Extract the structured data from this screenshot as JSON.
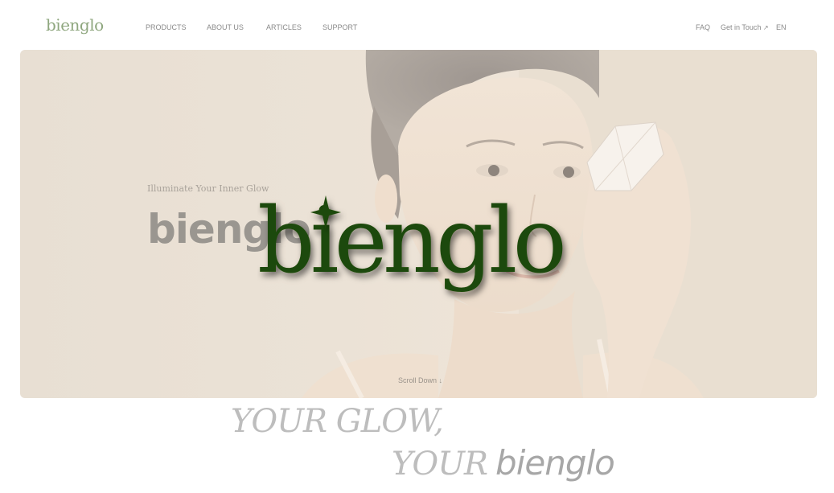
{
  "header": {
    "logo": "bienglo",
    "nav": [
      {
        "label": "PRODUCTS"
      },
      {
        "label": "ABOUT US"
      },
      {
        "label": "ARTICLES"
      },
      {
        "label": "SUPPORT"
      }
    ],
    "utility": {
      "faq": "FAQ",
      "contact": "Get in Touch",
      "contact_icon": "arrow-up-right-icon",
      "language": "EN"
    }
  },
  "hero": {
    "tagline": "Illuminate Your Inner Glow",
    "brand": "bienglo",
    "scroll_label": "Scroll Down",
    "scroll_icon": "arrow-down-icon"
  },
  "overlay": {
    "logo_text": "bienglo",
    "color": "#1f4a07",
    "icon": "sparkle-icon"
  },
  "slogan": {
    "line1": "YOUR GLOW,",
    "line2_prefix": "YOUR",
    "line2_brand": "bienglo"
  },
  "colors": {
    "logo": "#8fa77f",
    "nav_text": "#8a8a8a",
    "hero_bg": "#ebe2d6",
    "overlay_green": "#1f4a07"
  }
}
